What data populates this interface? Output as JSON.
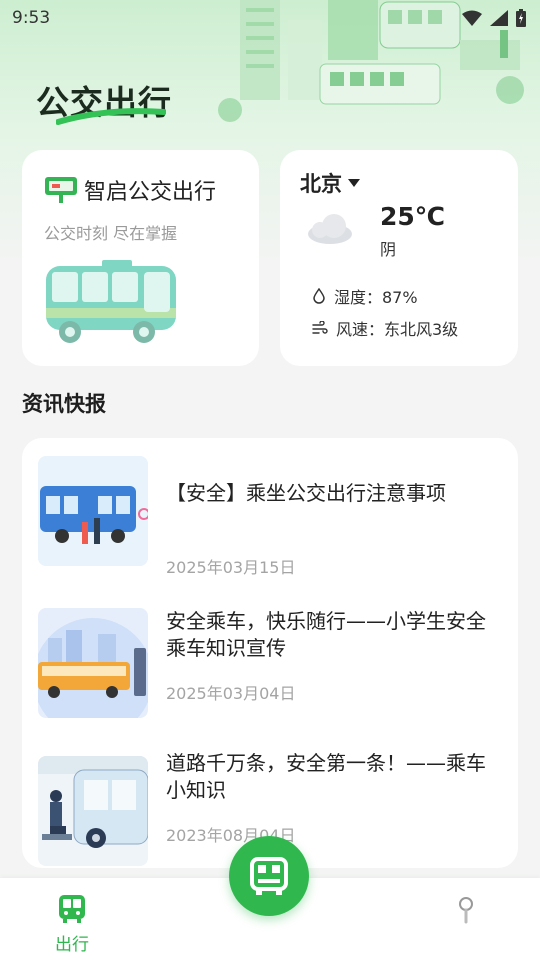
{
  "status_bar": {
    "time": "9:53"
  },
  "header": {
    "title": "公交出行"
  },
  "bus_card": {
    "title": "智启公交出行",
    "subtitle": "公交时刻 尽在掌握"
  },
  "weather": {
    "city": "北京",
    "temperature": "25℃",
    "condition": "阴",
    "humidity": "湿度：87%",
    "wind": "风速：东北风3级"
  },
  "news": {
    "section_title": "资讯快报",
    "items": [
      {
        "title": "【安全】乘坐公交出行注意事项",
        "date": "2025年03月15日"
      },
      {
        "title": "安全乘车，快乐随行——小学生安全乘车知识宣传",
        "date": "2025年03月04日"
      },
      {
        "title": "道路千万条，安全第一条！——乘车小知识",
        "date": "2023年08月04日"
      }
    ]
  },
  "tabbar": {
    "tab_go_label": "出行"
  },
  "colors": {
    "accent": "#30b84f",
    "header_bg": "#cdeed0"
  }
}
